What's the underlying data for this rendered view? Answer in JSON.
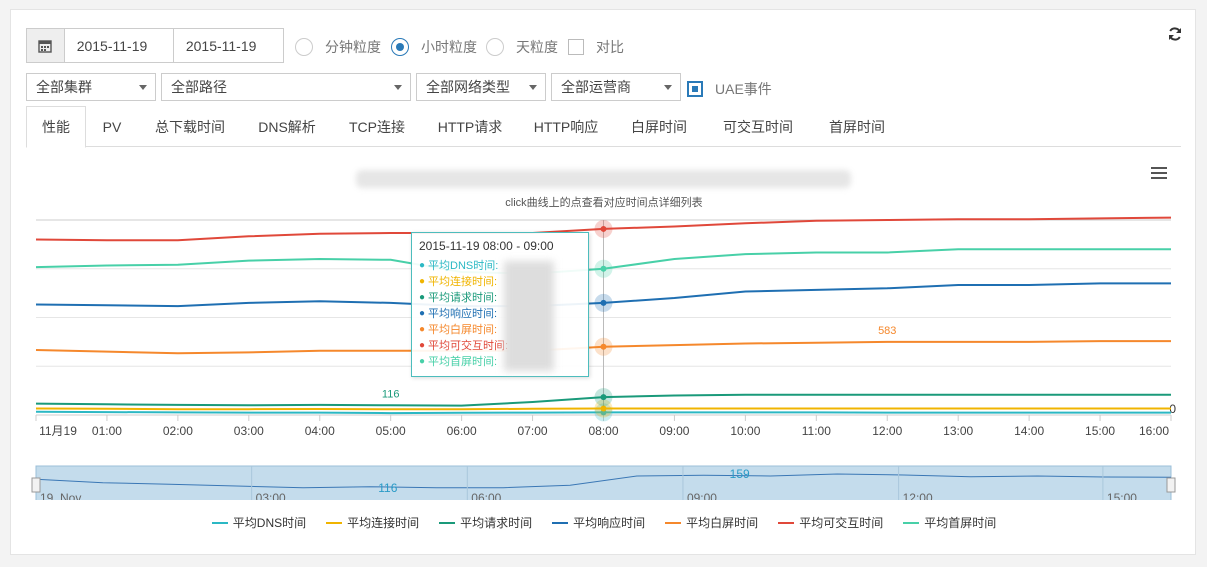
{
  "toolbar": {
    "calendar_icon": "calendar-icon",
    "date_from": "2015-11-19",
    "date_to": "2015-11-19",
    "granularity": [
      {
        "label": "分钟粒度",
        "selected": false
      },
      {
        "label": "小时粒度",
        "selected": true
      },
      {
        "label": "天粒度",
        "selected": false
      }
    ],
    "compare_label": "对比",
    "compare_checked": false,
    "refresh_icon": "refresh-icon"
  },
  "filters": {
    "cluster": "全部集群",
    "path": "全部路径",
    "network": "全部网络类型",
    "carrier": "全部运营商",
    "uae_label": "UAE事件",
    "uae_checked": true
  },
  "tabs": [
    "性能",
    "PV",
    "总下载时间",
    "DNS解析",
    "TCP连接",
    "HTTP请求",
    "HTTP响应",
    "白屏时间",
    "可交互时间",
    "首屏时间"
  ],
  "active_tab": "性能",
  "chart_data": {
    "type": "line",
    "title": "",
    "subtitle": "click曲线上的点查看对应时间点详细列表",
    "x": [
      "11月19",
      "01:00",
      "02:00",
      "03:00",
      "04:00",
      "05:00",
      "06:00",
      "07:00",
      "08:00",
      "09:00",
      "10:00",
      "11:00",
      "12:00",
      "13:00",
      "14:00",
      "15:00",
      "16:00"
    ],
    "ylim": [
      0,
      1200
    ],
    "y_visible_label": "0",
    "grid": true,
    "legend_placement": "bottom-center",
    "series": [
      {
        "name": "平均DNS时间",
        "color": "#2bb8c4",
        "values": [
          20,
          18,
          16,
          15,
          15,
          12,
          14,
          15,
          16,
          16,
          16,
          16,
          15,
          15,
          15,
          15,
          15
        ]
      },
      {
        "name": "平均连接时间",
        "color": "#f0b400",
        "values": [
          40,
          38,
          36,
          36,
          37,
          35,
          36,
          38,
          40,
          40,
          40,
          40,
          40,
          40,
          40,
          40,
          40
        ]
      },
      {
        "name": "平均请求时间",
        "color": "#1a9a7a",
        "values": [
          70,
          66,
          62,
          60,
          62,
          60,
          58,
          80,
          110,
          120,
          125,
          125,
          125,
          125,
          125,
          125,
          125
        ]
      },
      {
        "name": "平均响应时间",
        "color": "#1f6fb2",
        "values": [
          680,
          675,
          670,
          690,
          700,
          690,
          670,
          670,
          690,
          720,
          760,
          770,
          780,
          800,
          800,
          810,
          810
        ]
      },
      {
        "name": "平均白屏时间",
        "color": "#f5882c",
        "values": [
          400,
          390,
          380,
          385,
          395,
          395,
          395,
          395,
          420,
          430,
          440,
          445,
          450,
          450,
          450,
          455,
          455
        ]
      },
      {
        "name": "平均可交互时间",
        "color": "#e0483a",
        "values": [
          1080,
          1075,
          1075,
          1100,
          1115,
          1120,
          1120,
          1120,
          1145,
          1160,
          1180,
          1195,
          1200,
          1205,
          1205,
          1210,
          1215
        ]
      },
      {
        "name": "平均首屏时间",
        "color": "#48d0a8",
        "values": [
          910,
          920,
          925,
          950,
          960,
          955,
          880,
          870,
          900,
          960,
          990,
          1000,
          1000,
          1020,
          1020,
          1020,
          1020
        ]
      }
    ],
    "annotations": [
      {
        "x": "05:00",
        "series": "平均请求时间",
        "text": "116"
      },
      {
        "x": "12:00",
        "series": "平均白屏时间",
        "text": "583"
      }
    ]
  },
  "tooltip": {
    "title": "2015-11-19 08:00 - 09:00",
    "rows": [
      {
        "label": "平均DNS时间:",
        "color": "#2bb8c4"
      },
      {
        "label": "平均连接时间:",
        "color": "#f0b400"
      },
      {
        "label": "平均请求时间:",
        "color": "#1a9a7a"
      },
      {
        "label": "平均响应时间:",
        "color": "#1f6fb2"
      },
      {
        "label": "平均白屏时间:",
        "color": "#f5882c"
      },
      {
        "label": "平均可交互时间:",
        "color": "#e0483a"
      },
      {
        "label": "平均首屏时间:",
        "color": "#48d0a8"
      }
    ]
  },
  "navigator": {
    "labels": [
      "19. Nov",
      "03:00",
      "06:00",
      "09:00",
      "12:00",
      "15:00"
    ],
    "annotations": [
      "116",
      "159"
    ],
    "values": [
      80,
      70,
      65,
      60,
      55,
      58,
      55,
      55,
      62,
      90,
      92,
      90,
      96,
      93,
      88,
      90,
      87,
      86
    ]
  },
  "chart_menu_icon": "hamburger-menu-icon"
}
